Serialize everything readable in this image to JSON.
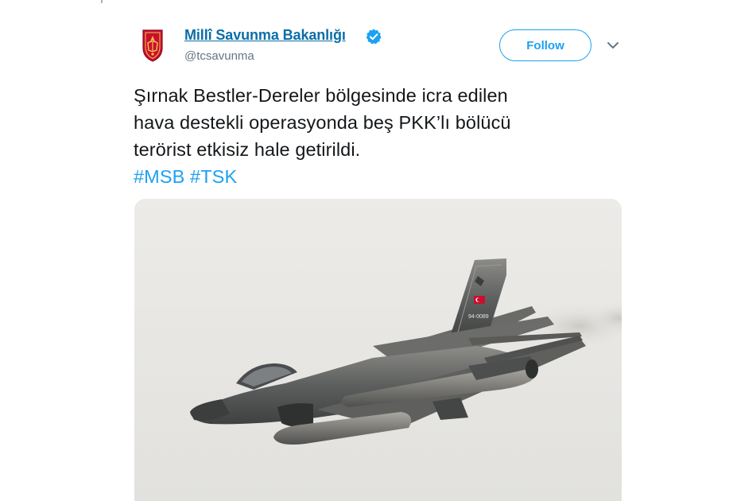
{
  "tweet": {
    "display_name": "Millî Savunma Bakanlığı",
    "handle": "@tcsavunma",
    "verified": true,
    "follow_label": "Follow",
    "text_lines": [
      "Şırnak Bestler-Dereler bölgesinde icra edilen",
      "hava destekli operasyonda beş PKK’lı bölücü",
      "terörist etkisiz hale getirildi."
    ],
    "hashtags": [
      "#MSB",
      "#TSK"
    ],
    "media": {
      "description_icon": "fighter-jet-photo",
      "tail_code": "94-0089"
    }
  },
  "colors": {
    "name_link": "#0a6ea8",
    "accent": "#1da1f2",
    "text": "#14171a",
    "secondary": "#657786",
    "sky": "#e7e6e3",
    "emblem_red": "#c8102e"
  }
}
